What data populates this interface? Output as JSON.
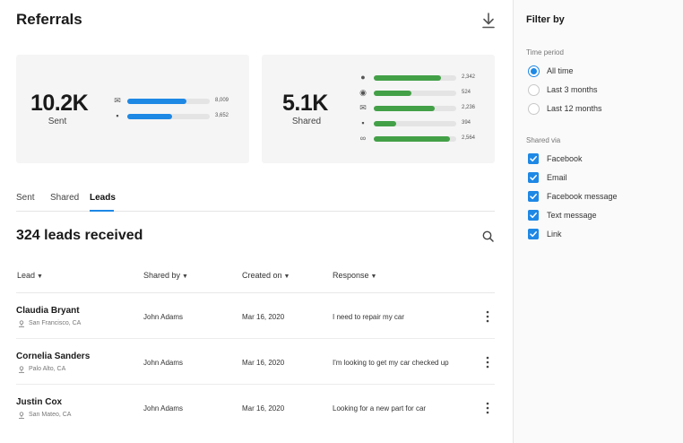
{
  "header": {
    "title": "Referrals",
    "download_icon": "download-icon"
  },
  "stats": {
    "sent": {
      "value": "10.2K",
      "label": "Sent",
      "bars": [
        {
          "icon": "email-icon",
          "value": "8,009",
          "fraction": 0.72,
          "color": "#1e88e5"
        },
        {
          "icon": "message-icon",
          "value": "3,652",
          "fraction": 0.54,
          "color": "#1e88e5"
        }
      ]
    },
    "shared": {
      "value": "5.1K",
      "label": "Shared",
      "bars": [
        {
          "icon": "facebook-icon",
          "value": "2,342",
          "fraction": 0.81,
          "color": "#43a047"
        },
        {
          "icon": "messenger-icon",
          "value": "524",
          "fraction": 0.46,
          "color": "#43a047"
        },
        {
          "icon": "email-icon",
          "value": "2,236",
          "fraction": 0.74,
          "color": "#43a047"
        },
        {
          "icon": "message-icon",
          "value": "394",
          "fraction": 0.27,
          "color": "#43a047"
        },
        {
          "icon": "link-icon",
          "value": "2,564",
          "fraction": 0.92,
          "color": "#43a047"
        }
      ]
    }
  },
  "tabs": [
    {
      "label": "Sent",
      "active": false
    },
    {
      "label": "Shared",
      "active": false
    },
    {
      "label": "Leads",
      "active": true
    }
  ],
  "leads": {
    "heading": "324 leads received",
    "columns": [
      "Lead",
      "Shared by",
      "Created on",
      "Response"
    ],
    "rows": [
      {
        "name": "Claudia Bryant",
        "location": "San Francisco, CA",
        "shared_by": "John Adams",
        "created_on": "Mar 16, 2020",
        "response": "I need to repair my car"
      },
      {
        "name": "Cornelia Sanders",
        "location": "Palo Alto, CA",
        "shared_by": "John Adams",
        "created_on": "Mar 16, 2020",
        "response": "I'm looking to get my car checked up"
      },
      {
        "name": "Justin Cox",
        "location": "San Mateo, CA",
        "shared_by": "John Adams",
        "created_on": "Mar 16, 2020",
        "response": "Looking for a new part for car"
      }
    ]
  },
  "filter": {
    "title": "Filter by",
    "time_period_label": "Time period",
    "time_options": [
      {
        "label": "All time",
        "selected": true
      },
      {
        "label": "Last 3 months",
        "selected": false
      },
      {
        "label": "Last 12 months",
        "selected": false
      }
    ],
    "shared_via_label": "Shared via",
    "shared_options": [
      {
        "label": "Facebook",
        "checked": true
      },
      {
        "label": "Email",
        "checked": true
      },
      {
        "label": "Facebook message",
        "checked": true
      },
      {
        "label": "Text message",
        "checked": true
      },
      {
        "label": "Link",
        "checked": true
      }
    ]
  },
  "colors": {
    "accent": "#1e88e5",
    "shared_bar": "#43a047"
  }
}
